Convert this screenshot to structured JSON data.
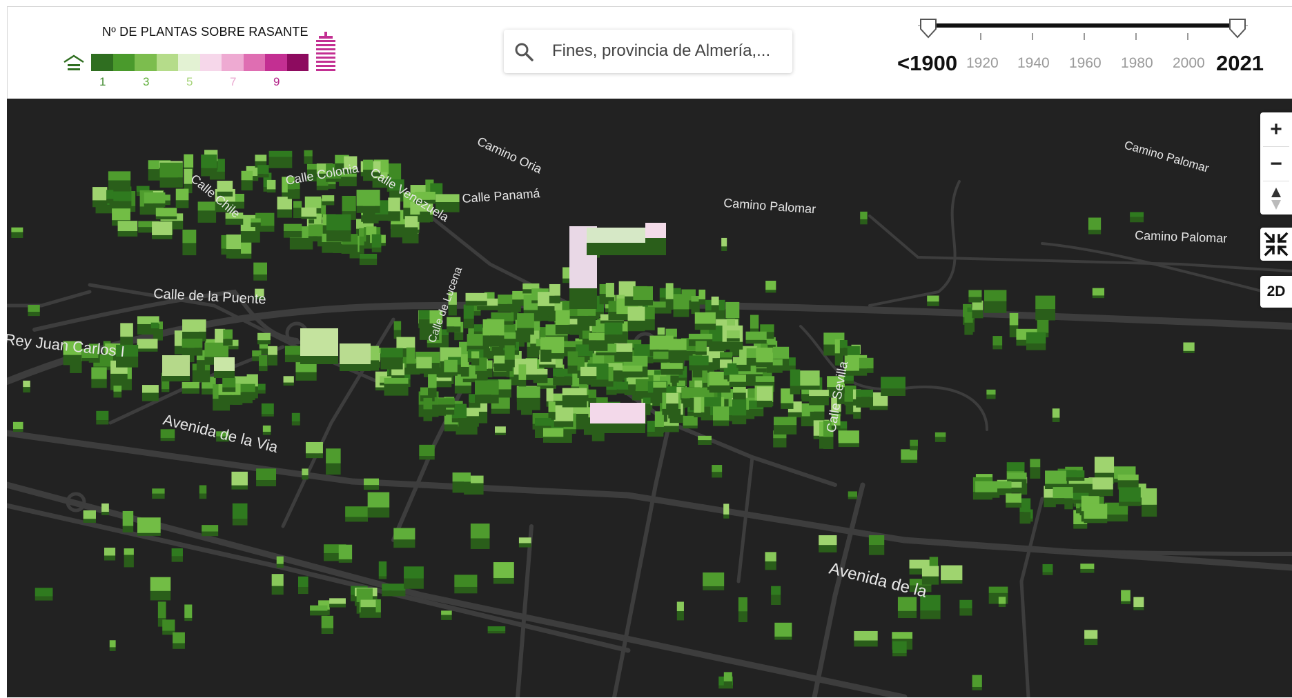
{
  "legend": {
    "title": "Nº DE PLANTAS SOBRE RASANTE",
    "low_icon": "low-building-icon",
    "high_icon": "tall-building-icon",
    "colors": [
      "#2f6e20",
      "#4a9a2c",
      "#7cbd4e",
      "#b5dc8a",
      "#e3f2d3",
      "#f6d7ea",
      "#eeaad2",
      "#df6eb2",
      "#c32f92",
      "#8d0b5f"
    ],
    "numbers": [
      {
        "label": "1",
        "color": "#3f8a2e"
      },
      {
        "label": "3",
        "color": "#5fae3a"
      },
      {
        "label": "5",
        "color": "#a7d47a"
      },
      {
        "label": "7",
        "color": "#eaa7cf"
      },
      {
        "label": "9",
        "color": "#b4268a"
      }
    ]
  },
  "search": {
    "placeholder": "Fines, provincia de Almería,...",
    "icon": "search-icon"
  },
  "timeline": {
    "start_label": "<1900",
    "end_label": "2021",
    "ticks": [
      "1920",
      "1940",
      "1960",
      "1980",
      "2000"
    ],
    "range_start": 1900,
    "range_end": 2021
  },
  "map": {
    "background": "#222222",
    "road_color": "#3d3d3d",
    "street_labels": [
      "Calle Colonia",
      "Calle Venezuela",
      "Calle Chile",
      "Camino Oria",
      "Calle Panamá",
      "Camino Palomar",
      "Camino Palomar",
      "Camino Palomar",
      "Calle de la Puente",
      "Rey Juan Carlos I",
      "Avenida de la Via",
      "Calle Sevilla",
      "Calle de Lucena",
      "Avenida de la"
    ]
  },
  "controls": {
    "zoom_in": "+",
    "zoom_out": "−",
    "mode": "2D",
    "compass_icon": "compass-icon",
    "collapse_icon": "collapse-icon"
  }
}
